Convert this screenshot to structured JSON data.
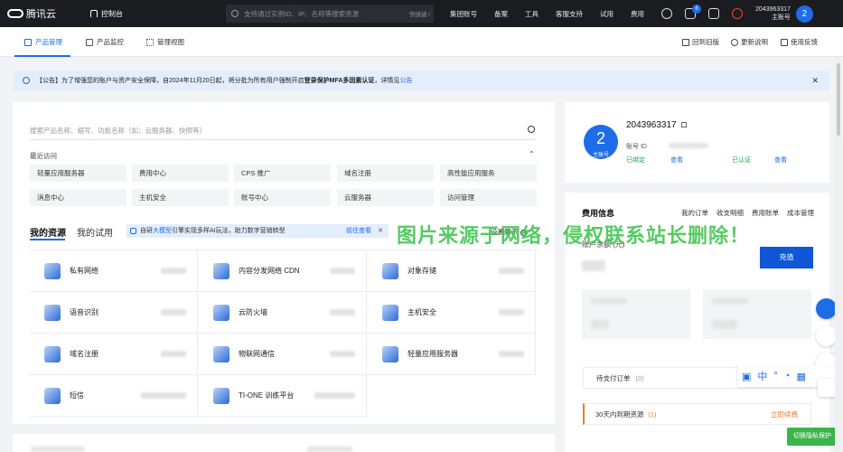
{
  "topbar": {
    "brand": "腾讯云",
    "console": "控制台",
    "search_placeholder": "支持通过实例ID、IP、名称等搜索资源",
    "shortcut": "快捷键 /",
    "nav": [
      "集团账号",
      "备案",
      "工具",
      "客服支持",
      "试用",
      "费用"
    ],
    "notification_count": "6",
    "account_id": "2043963317",
    "account_role": "主账号",
    "avatar_letter": "2"
  },
  "tabs": {
    "items": [
      "产品管理",
      "产品监控",
      "管理视图"
    ],
    "active": "产品管理",
    "right": [
      "回到旧版",
      "更新说明",
      "使用反馈"
    ]
  },
  "notice": {
    "prefix": "【公告】为了增强您的账户与资产安全保障，自2024年11月20日起，将分批为所有用户强制开启",
    "bold": "登录保护MFA多因素认证",
    "suffix": "，详情见",
    "link": "公告"
  },
  "products": {
    "search_placeholder": "搜索产品名称、缩写、功能名称（如：云服务器、快照等）",
    "recent_title": "最近访问",
    "recent": [
      "轻量应用服务器",
      "费用中心",
      "CPS 推广",
      "域名注册",
      "高性能应用服务",
      "消息中心",
      "主机安全",
      "账号中心",
      "云服务器",
      "访问管理"
    ]
  },
  "resources": {
    "tabs": [
      "我的资源",
      "我的试用"
    ],
    "promo_prefix": "自研",
    "promo_highlight": "大模型",
    "promo_suffix": "引擎实现多样AI玩法，助力数字营销转型",
    "promo_link": "前往查看",
    "settings": "设置展示",
    "items": [
      "私有网络",
      "内容分发网络 CDN",
      "对象存储",
      "语音识别",
      "云防火墙",
      "主机安全",
      "域名注册",
      "物联网通信",
      "轻量应用服务器",
      "短信",
      "TI-ONE 训练平台"
    ]
  },
  "account": {
    "id": "2043963317",
    "avatar_letter": "2",
    "avatar_sub": "主账号",
    "id_label": "账号 ID",
    "bound": "已绑定",
    "view": "查看",
    "verified": "已认证",
    "view2": "查看"
  },
  "fees": {
    "title": "费用信息",
    "links": [
      "我的订单",
      "收支明细",
      "费用账单",
      "成本管理"
    ],
    "balance_label": "账户余额 (元)",
    "charge": "充值",
    "pending_orders": "待支付订单",
    "pending_count": "(0)",
    "expiring": "30天内到期资源",
    "expiring_count": "(1)",
    "renew": "立即续费"
  },
  "overlay": {
    "watermark": "图片来源于网络，侵权联系站长删除！",
    "toolstrip": "中",
    "privacy": "切换隐私保护"
  }
}
